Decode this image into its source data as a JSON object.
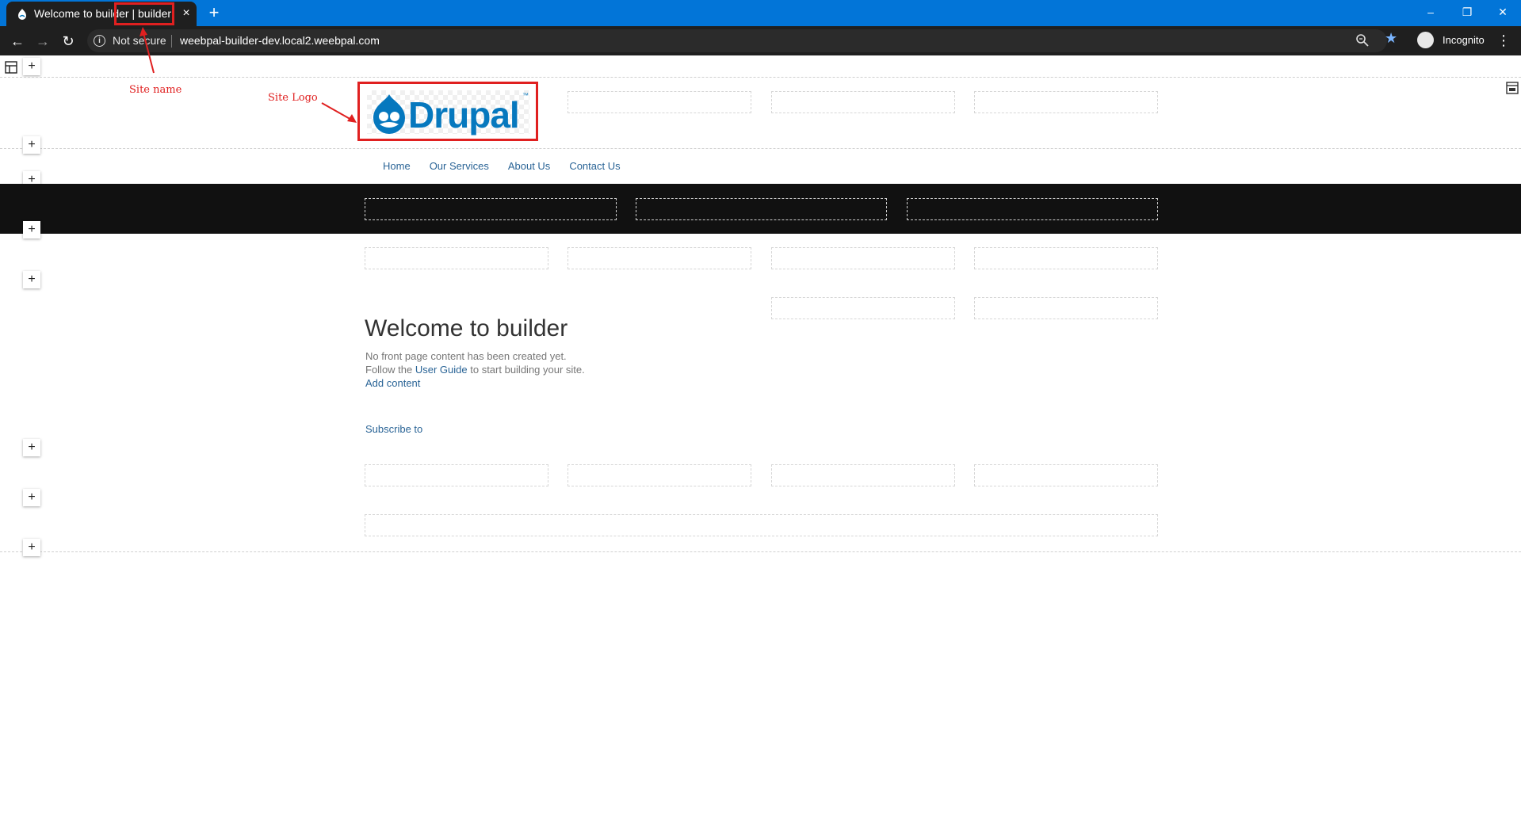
{
  "browser": {
    "tab_title": "Welcome to builder | builder",
    "tab_close": "×",
    "new_tab": "+",
    "security_label": "Not secure",
    "url": "weebpal-builder-dev.local2.weebpal.com",
    "profile_label": "Incognito",
    "window_controls": {
      "minimize": "–",
      "restore": "❐",
      "close": "✕"
    }
  },
  "annotations": {
    "site_name": "Site name",
    "site_logo": "Site Logo",
    "color": "#e02020"
  },
  "site": {
    "logo_text": "Drupal",
    "logo_tm": "™",
    "nav": [
      "Home",
      "Our Services",
      "About Us",
      "Contact Us"
    ]
  },
  "content": {
    "title": "Welcome to builder",
    "line1": "No front page content has been created yet.",
    "line2_prefix": "Follow the ",
    "line2_link": "User Guide",
    "line2_suffix": " to start building your site.",
    "add_content": "Add content",
    "subscribe": "Subscribe to"
  },
  "builder": {
    "plus_label": "+"
  },
  "colors": {
    "tabbar": "#0275d8",
    "chrome_dark": "#1f1f1f",
    "band": "#111111",
    "link": "#2a6496"
  }
}
